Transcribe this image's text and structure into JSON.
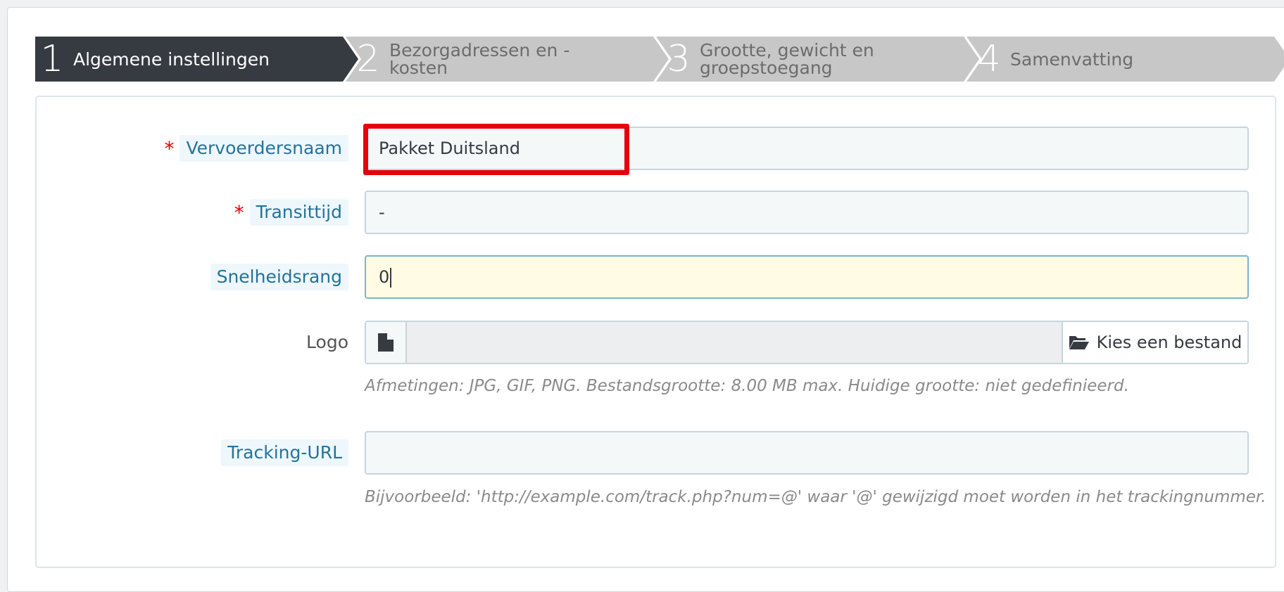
{
  "wizard": {
    "steps": [
      {
        "number": "1",
        "label": "Algemene instellingen"
      },
      {
        "number": "2",
        "label": "Bezorgadressen en -kosten"
      },
      {
        "number": "3",
        "label": "Grootte, gewicht en groepstoegang"
      },
      {
        "number": "4",
        "label": "Samenvatting"
      }
    ],
    "active_step": 1
  },
  "form": {
    "carrier_name": {
      "label": "Vervoerdersnaam",
      "required_mark": "*",
      "value": "Pakket Duitsland"
    },
    "transit_time": {
      "label": "Transittijd",
      "required_mark": "*",
      "value": "-"
    },
    "speed_grade": {
      "label": "Snelheidsrang",
      "value": "0"
    },
    "logo": {
      "label": "Logo",
      "button_label": "Kies een bestand",
      "help": "Afmetingen: JPG, GIF, PNG. Bestandsgrootte: 8.00 MB max. Huidige grootte: niet gedefinieerd."
    },
    "tracking_url": {
      "label": "Tracking-URL",
      "value": "",
      "help": "Bijvoorbeeld: 'http://example.com/track.php?num=@' waar '@' gewijzigd moet worden in het trackingnummer."
    }
  },
  "colors": {
    "active_step": "#363a41",
    "inactive_step": "#c7c7c7",
    "label_accent": "#25739b",
    "required": "#e20000",
    "highlight": "#e6000b",
    "focused_field": "#fffbe5"
  },
  "icons": {
    "file": "file-icon",
    "folder": "folder-open-icon"
  }
}
